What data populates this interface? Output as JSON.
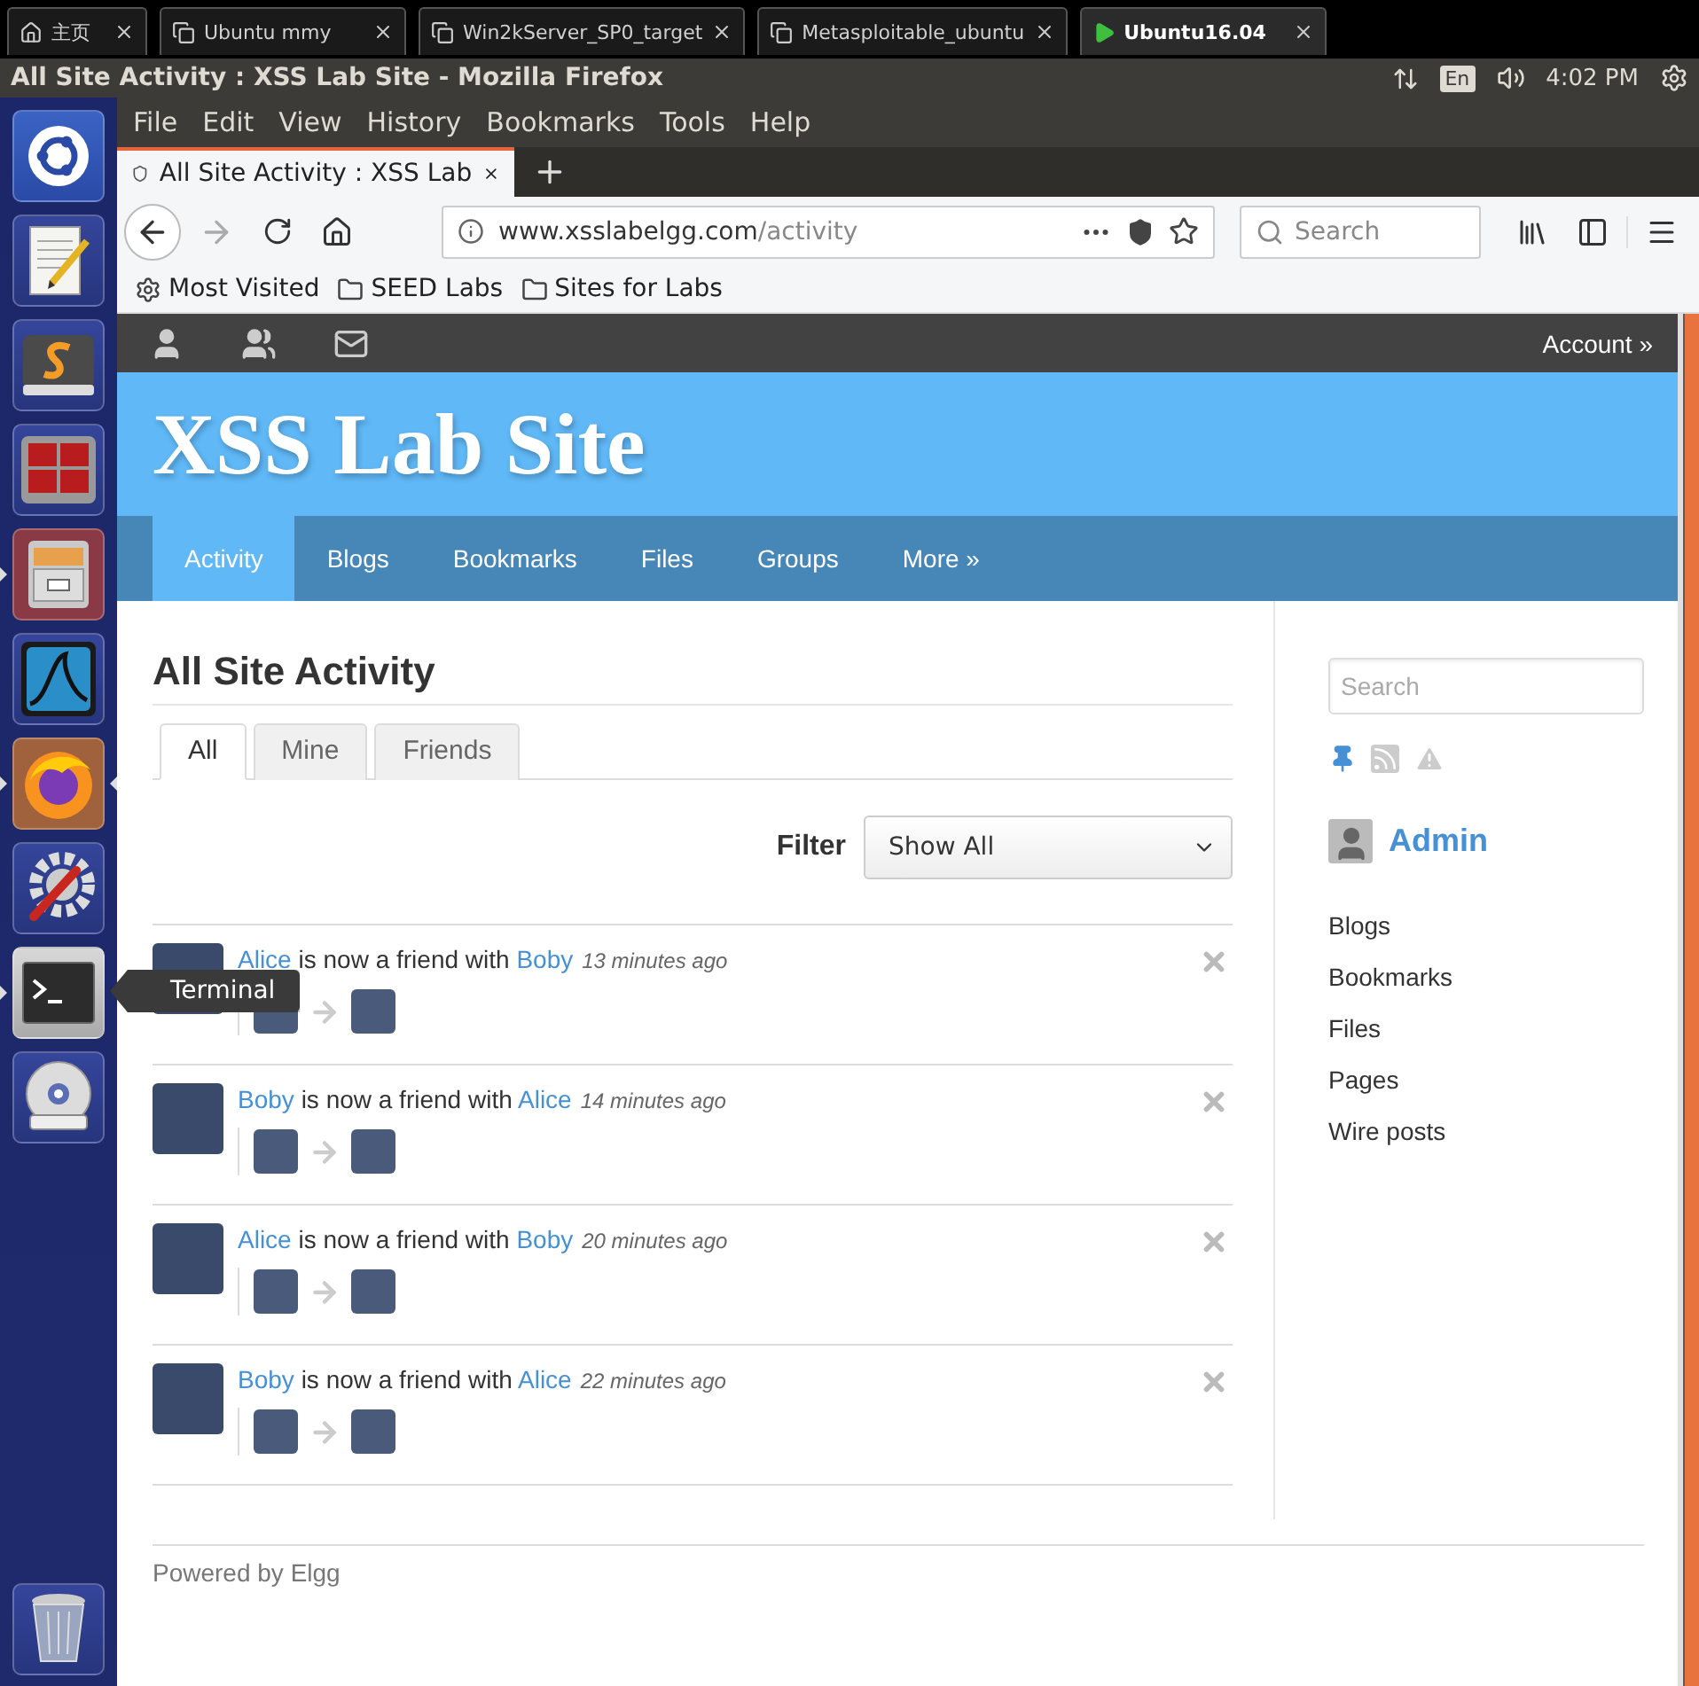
{
  "vm_tabs": [
    {
      "kind": "home",
      "label": "主页",
      "selected": false
    },
    {
      "kind": "vm",
      "label": "Ubuntu mmy",
      "selected": false
    },
    {
      "kind": "vm",
      "label": "Win2kServer_SP0_target",
      "selected": false
    },
    {
      "kind": "vm",
      "label": "Metasploitable_ubuntu",
      "selected": false
    },
    {
      "kind": "vm",
      "label": "Ubuntu16.04",
      "selected": true
    }
  ],
  "top_bar": {
    "window_title": "All Site Activity : XSS Lab Site - Mozilla Firefox",
    "keyboard": "En",
    "time": "4:02 PM"
  },
  "launcher": [
    {
      "kind": "dash",
      "running": false,
      "focused": false
    },
    {
      "kind": "notepad",
      "running": false,
      "focused": false
    },
    {
      "kind": "code",
      "running": false,
      "focused": false
    },
    {
      "kind": "tiles",
      "running": false,
      "focused": false
    },
    {
      "kind": "cabinet",
      "running": true,
      "focused": false
    },
    {
      "kind": "fin",
      "running": false,
      "focused": false
    },
    {
      "kind": "browser",
      "running": true,
      "focused": true
    },
    {
      "kind": "tools",
      "running": false,
      "focused": false
    },
    {
      "kind": "terminal",
      "running": true,
      "focused": false,
      "tooltip": "Terminal"
    },
    {
      "kind": "disc",
      "running": false,
      "focused": false
    },
    {
      "kind": "trash",
      "running": false,
      "focused": false
    }
  ],
  "browser": {
    "menu": [
      "File",
      "Edit",
      "View",
      "History",
      "Bookmarks",
      "Tools",
      "Help"
    ],
    "tabs": [
      {
        "title": "All Site Activity : XSS Lab",
        "selected": true
      }
    ],
    "url": {
      "host": "www.xsslabelgg.com",
      "path": "/activity"
    },
    "search_placeholder": "Search",
    "bookmarks": [
      {
        "kind": "smart",
        "label": "Most Visited"
      },
      {
        "kind": "folder",
        "label": "SEED Labs"
      },
      {
        "kind": "folder",
        "label": "Sites for Labs"
      }
    ]
  },
  "site": {
    "account": "Account »",
    "title": "XSS Lab Site",
    "nav": [
      {
        "label": "Activity",
        "selected": true
      },
      {
        "label": "Blogs",
        "selected": false
      },
      {
        "label": "Bookmarks",
        "selected": false
      },
      {
        "label": "Files",
        "selected": false
      },
      {
        "label": "Groups",
        "selected": false
      },
      {
        "label": "More »",
        "selected": false
      }
    ],
    "heading": "All Site Activity",
    "filter_tabs": [
      {
        "label": "All",
        "selected": true
      },
      {
        "label": "Mine",
        "selected": false
      },
      {
        "label": "Friends",
        "selected": false
      }
    ],
    "filter": {
      "label": "Filter",
      "value": "Show All"
    },
    "activities": [
      {
        "subject": "Alice",
        "verb": "is now a friend with",
        "object": "Boby",
        "time": "13 minutes ago"
      },
      {
        "subject": "Boby",
        "verb": "is now a friend with",
        "object": "Alice",
        "time": "14 minutes ago"
      },
      {
        "subject": "Alice",
        "verb": "is now a friend with",
        "object": "Boby",
        "time": "20 minutes ago"
      },
      {
        "subject": "Boby",
        "verb": "is now a friend with",
        "object": "Alice",
        "time": "22 minutes ago"
      }
    ],
    "sidebar": {
      "search_placeholder": "Search",
      "owner": "Admin",
      "menu": [
        "Blogs",
        "Bookmarks",
        "Files",
        "Pages",
        "Wire posts"
      ]
    },
    "footer": "Powered by Elgg"
  }
}
